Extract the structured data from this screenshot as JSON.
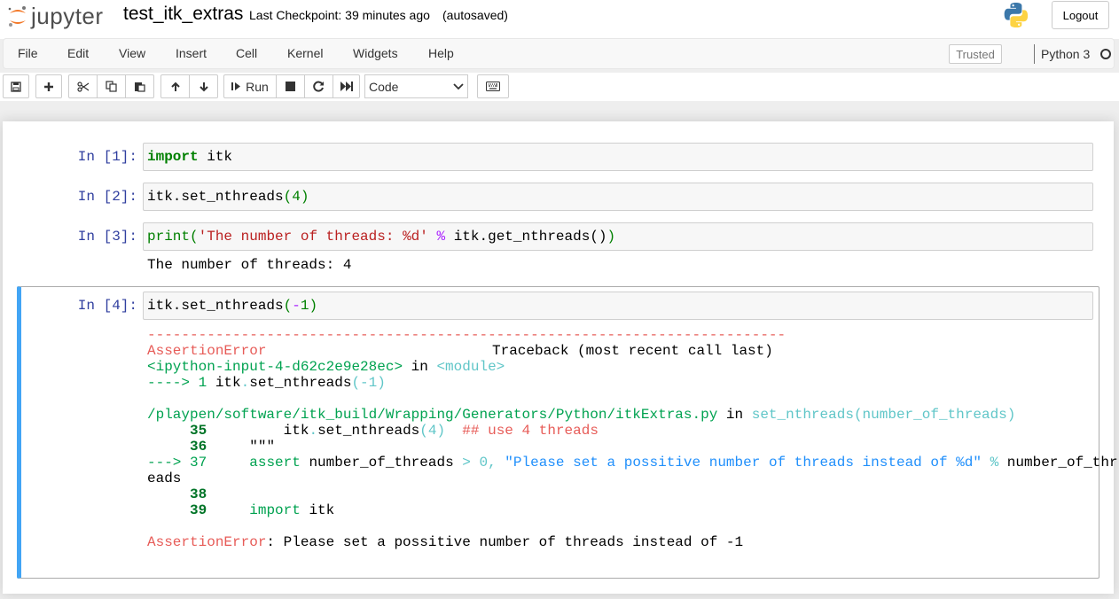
{
  "header": {
    "logo_text": "jupyter",
    "notebook_name": "test_itk_extras",
    "checkpoint": "Last Checkpoint: 39 minutes ago",
    "autosaved": "(autosaved)",
    "logout": "Logout"
  },
  "menu": {
    "items": [
      "File",
      "Edit",
      "View",
      "Insert",
      "Cell",
      "Kernel",
      "Widgets",
      "Help"
    ],
    "trusted": "Trusted",
    "kernel": "Python 3"
  },
  "toolbar": {
    "run_label": "Run",
    "cell_type": "Code",
    "icons": [
      "save-icon",
      "plus-icon",
      "cut-icon",
      "copy-icon",
      "paste-icon",
      "arrow-up-icon",
      "arrow-down-icon",
      "run-icon",
      "stop-icon",
      "restart-icon",
      "fast-forward-icon",
      "keyboard-icon"
    ]
  },
  "cells": [
    {
      "prompt": "In [1]:",
      "code": {
        "kw": "import",
        "rest": " itk"
      }
    },
    {
      "prompt": "In [2]:",
      "code": {
        "a": "itk.set_nthreads",
        "b": "(",
        "c": "4",
        "d": ")"
      }
    },
    {
      "prompt": "In [3]:",
      "code": {
        "fn": "print",
        "p1": "(",
        "str": "'The number of threads: %d'",
        "sp": " ",
        "op": "%",
        "rest": " itk.get_nthreads()",
        "p2": ")"
      },
      "output": "The number of threads: 4"
    },
    {
      "prompt": "In [4]:",
      "code": {
        "a": "itk.set_nthreads",
        "b": "(",
        "op": "-",
        "c": "1",
        "d": ")"
      }
    }
  ],
  "traceback": {
    "dashes": "---------------------------------------------------------------------------",
    "error_name": "AssertionError",
    "traceback_header": "Traceback (most recent call last)",
    "input_ref": "<ipython-input-4-d62c2e9e28ec>",
    "in_word": " in ",
    "module_ref": "<module>",
    "arrow1": "----> 1 ",
    "arrow1_code": "itk",
    "arrow1_dot": ".",
    "arrow1_fn": "set_nthreads",
    "arrow1_args": "(-1)",
    "file_path": "/playpen/software/itk_build/Wrapping/Generators/Python/itkExtras.py",
    "in_word2": " in ",
    "func_sig": "set_nthreads(number_of_threads)",
    "line35_no": "35",
    "line35_code": "itk",
    "line35_dot": ".",
    "line35_fn": "set_nthreads",
    "line35_args": "(4)",
    "line35_comment": "## use 4 threads",
    "line36_no": "36",
    "line36_code": "\"\"\"",
    "line37_arrow": "---> 37",
    "line37_assert": "assert",
    "line37_var": " number_of_threads ",
    "line37_gt": "> 0,",
    "line37_str": " \"Please set a possitive number of threads instead of %d\"",
    "line37_pct": " %",
    "line37_tail": " number_of_thr",
    "line37_wrap": "eads",
    "line38_no": "38",
    "line39_no": "39",
    "line39_import": "import",
    "line39_rest": " itk",
    "final_error_name": "AssertionError",
    "final_error_msg": ": Please set a possitive number of threads instead of -1"
  }
}
